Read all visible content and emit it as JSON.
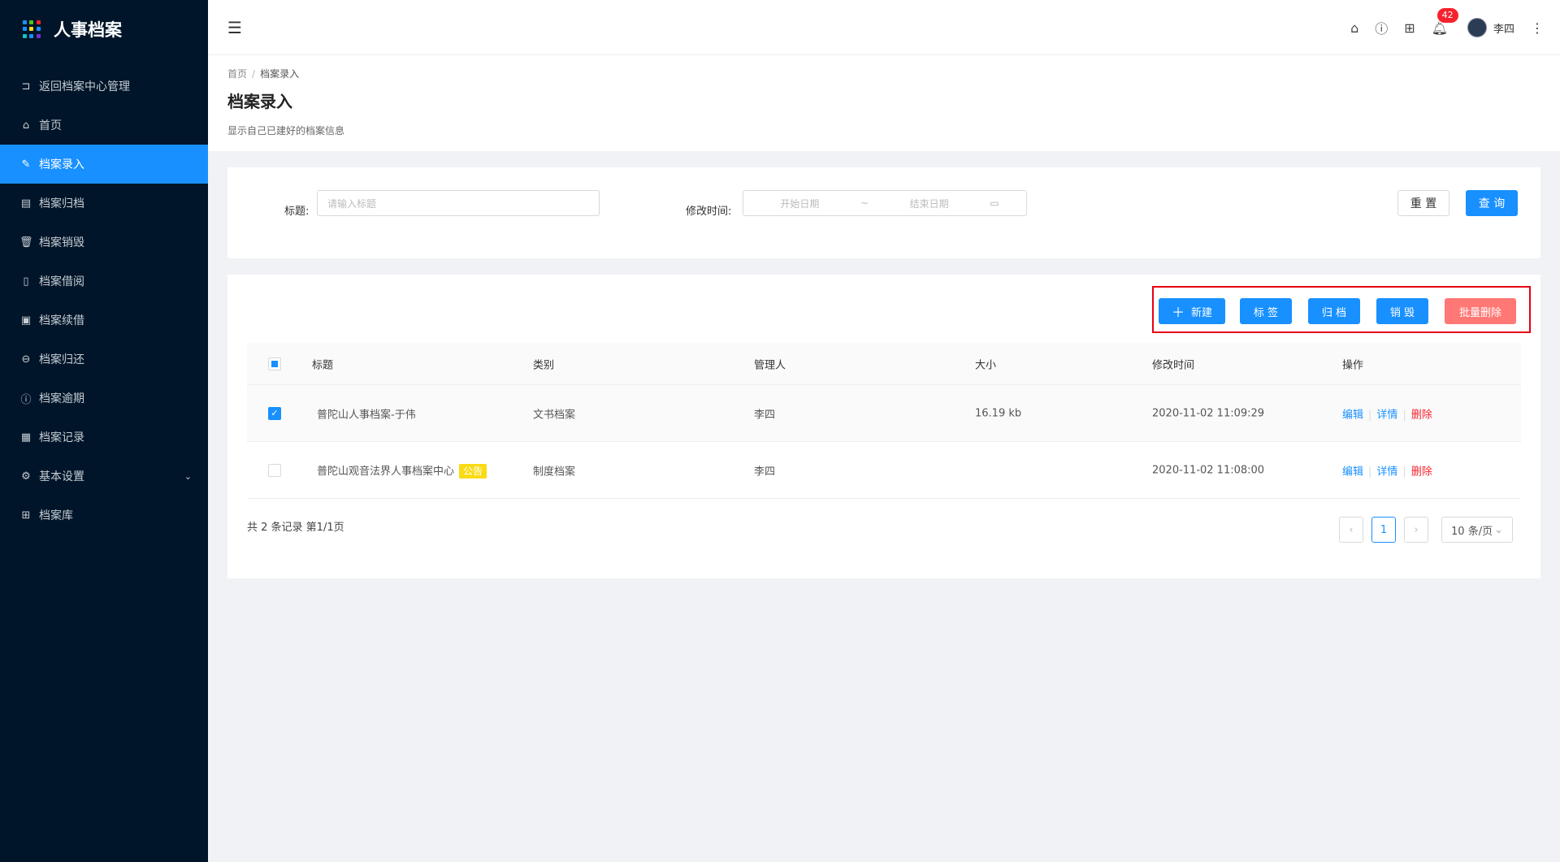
{
  "app": {
    "title": "人事档案",
    "logo_colors": [
      "#1890ff",
      "#52c41a",
      "#f5222d",
      "#1890ff",
      "#fadb14",
      "#1890ff",
      "#13c2c2",
      "#1890ff",
      "#722ed1"
    ]
  },
  "sidebar": {
    "items": [
      {
        "icon": "back-icon",
        "label": "返回档案中心管理"
      },
      {
        "icon": "home-icon",
        "label": "首页"
      },
      {
        "icon": "edit-icon",
        "label": "档案录入"
      },
      {
        "icon": "archive-icon",
        "label": "档案归档"
      },
      {
        "icon": "trash-icon",
        "label": "档案销毁"
      },
      {
        "icon": "file-icon",
        "label": "档案借阅"
      },
      {
        "icon": "renew-icon",
        "label": "档案续借"
      },
      {
        "icon": "return-icon",
        "label": "档案归还"
      },
      {
        "icon": "clock-icon",
        "label": "档案逾期"
      },
      {
        "icon": "record-icon",
        "label": "档案记录"
      },
      {
        "icon": "gear-icon",
        "label": "基本设置"
      },
      {
        "icon": "grid-icon",
        "label": "档案库"
      }
    ],
    "active_index": 2
  },
  "header": {
    "notification_count": "42",
    "username": "李四"
  },
  "page": {
    "breadcrumb": [
      "首页",
      "档案录入"
    ],
    "title": "档案录入",
    "description": "显示自己已建好的档案信息"
  },
  "search": {
    "title_label": "标题:",
    "title_placeholder": "请输入标题",
    "time_label": "修改时间:",
    "start_placeholder": "开始日期",
    "range_sep": "~",
    "end_placeholder": "结束日期",
    "reset_label": "重 置",
    "query_label": "查 询"
  },
  "toolbar": {
    "new_label": "新建",
    "tag_label": "标 签",
    "archive_label": "归 档",
    "destroy_label": "销 毁",
    "batch_delete_label": "批量删除"
  },
  "table": {
    "columns": [
      "标题",
      "类别",
      "管理人",
      "大小",
      "修改时间",
      "操作"
    ],
    "rows": [
      {
        "title": "普陀山人事档案-于伟",
        "tag": "",
        "category": "文书档案",
        "manager": "李四",
        "size": "16.19 kb",
        "modified": "2020-11-02 11:09:29",
        "checked": true
      },
      {
        "title": "普陀山观音法界人事档案中心",
        "tag": "公告",
        "category": "制度档案",
        "manager": "李四",
        "size": "",
        "modified": "2020-11-02 11:08:00",
        "checked": false
      }
    ],
    "actions": {
      "edit": "编辑",
      "detail": "详情",
      "delete": "删除"
    }
  },
  "pagination": {
    "summary": "共 2 条记录 第1/1页",
    "current_page": "1",
    "page_size": "10 条/页"
  }
}
